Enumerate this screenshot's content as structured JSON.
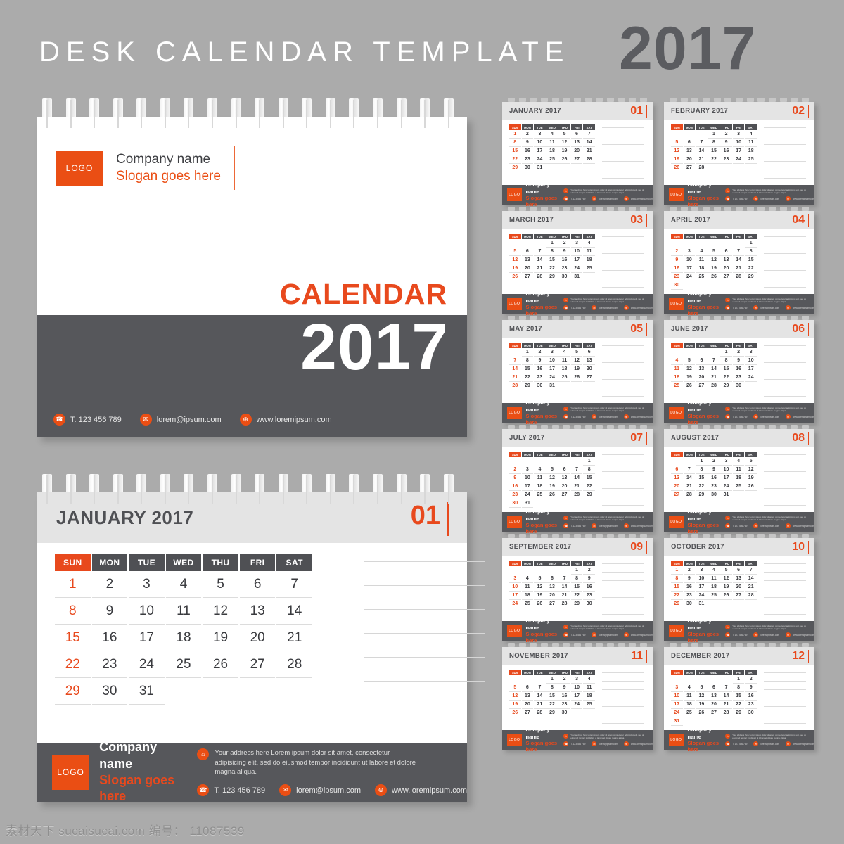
{
  "header": {
    "title": "DESK  CALENDAR  TEMPLATE",
    "year": "2017"
  },
  "brand": {
    "logo_label": "LOGO",
    "company": "Company name",
    "slogan": "Slogan goes here"
  },
  "cover": {
    "calendar_label": "CALENDAR",
    "year": "2017",
    "contacts": [
      {
        "icon": "phone-icon",
        "glyph": "☎",
        "text": "T. 123 456 789"
      },
      {
        "icon": "mail-icon",
        "glyph": "✉",
        "text": "lorem@ipsum.com"
      },
      {
        "icon": "globe-icon",
        "glyph": "⊕",
        "text": "www.loremipsum.com"
      }
    ]
  },
  "footer": {
    "address": "Your address here Lorem ipsum dolor sit amet, consectetur adipisicing elit, sed do eiusmod tempor incididunt ut labore et dolore magna aliqua.",
    "address_icon": "home-icon",
    "address_glyph": "⌂",
    "contacts": [
      {
        "icon": "phone-icon",
        "glyph": "☎",
        "text": "T. 123 456 789"
      },
      {
        "icon": "mail-icon",
        "glyph": "✉",
        "text": "lorem@ipsum.com"
      },
      {
        "icon": "globe-icon",
        "glyph": "⊕",
        "text": "www.loremipsum.com"
      }
    ]
  },
  "weekdays": [
    "SUN",
    "MON",
    "TUE",
    "WED",
    "THU",
    "FRI",
    "SAT"
  ],
  "big_month": {
    "title": "JANUARY 2017",
    "number": "01",
    "note_lines": 7
  },
  "colors": {
    "background": "#ababab",
    "accent_orange": "#e8491d",
    "logo_orange": "#ea4e14",
    "dark_gray": "#56575b",
    "header_gray": "#e4e4e4",
    "title_white": "#ffffff",
    "year_gray": "#5b5c60"
  },
  "months": [
    {
      "title": "JANUARY 2017",
      "number": "01",
      "start": 0,
      "days": 31
    },
    {
      "title": "FEBRUARY 2017",
      "number": "02",
      "start": 3,
      "days": 28
    },
    {
      "title": "MARCH 2017",
      "number": "03",
      "start": 3,
      "days": 31
    },
    {
      "title": "APRIL 2017",
      "number": "04",
      "start": 6,
      "days": 30
    },
    {
      "title": "MAY 2017",
      "number": "05",
      "start": 1,
      "days": 31
    },
    {
      "title": "JUNE 2017",
      "number": "06",
      "start": 4,
      "days": 30
    },
    {
      "title": "JULY 2017",
      "number": "07",
      "start": 6,
      "days": 31
    },
    {
      "title": "AUGUST 2017",
      "number": "08",
      "start": 2,
      "days": 31
    },
    {
      "title": "SEPTEMBER 2017",
      "number": "09",
      "start": 5,
      "days": 30
    },
    {
      "title": "OCTOBER 2017",
      "number": "10",
      "start": 0,
      "days": 31
    },
    {
      "title": "NOVEMBER 2017",
      "number": "11",
      "start": 3,
      "days": 30
    },
    {
      "title": "DECEMBER 2017",
      "number": "12",
      "start": 5,
      "days": 31
    }
  ],
  "watermark": {
    "site": "素材天下 sucaisucai.com",
    "id_label": "编号：",
    "id_value": "11087539"
  }
}
